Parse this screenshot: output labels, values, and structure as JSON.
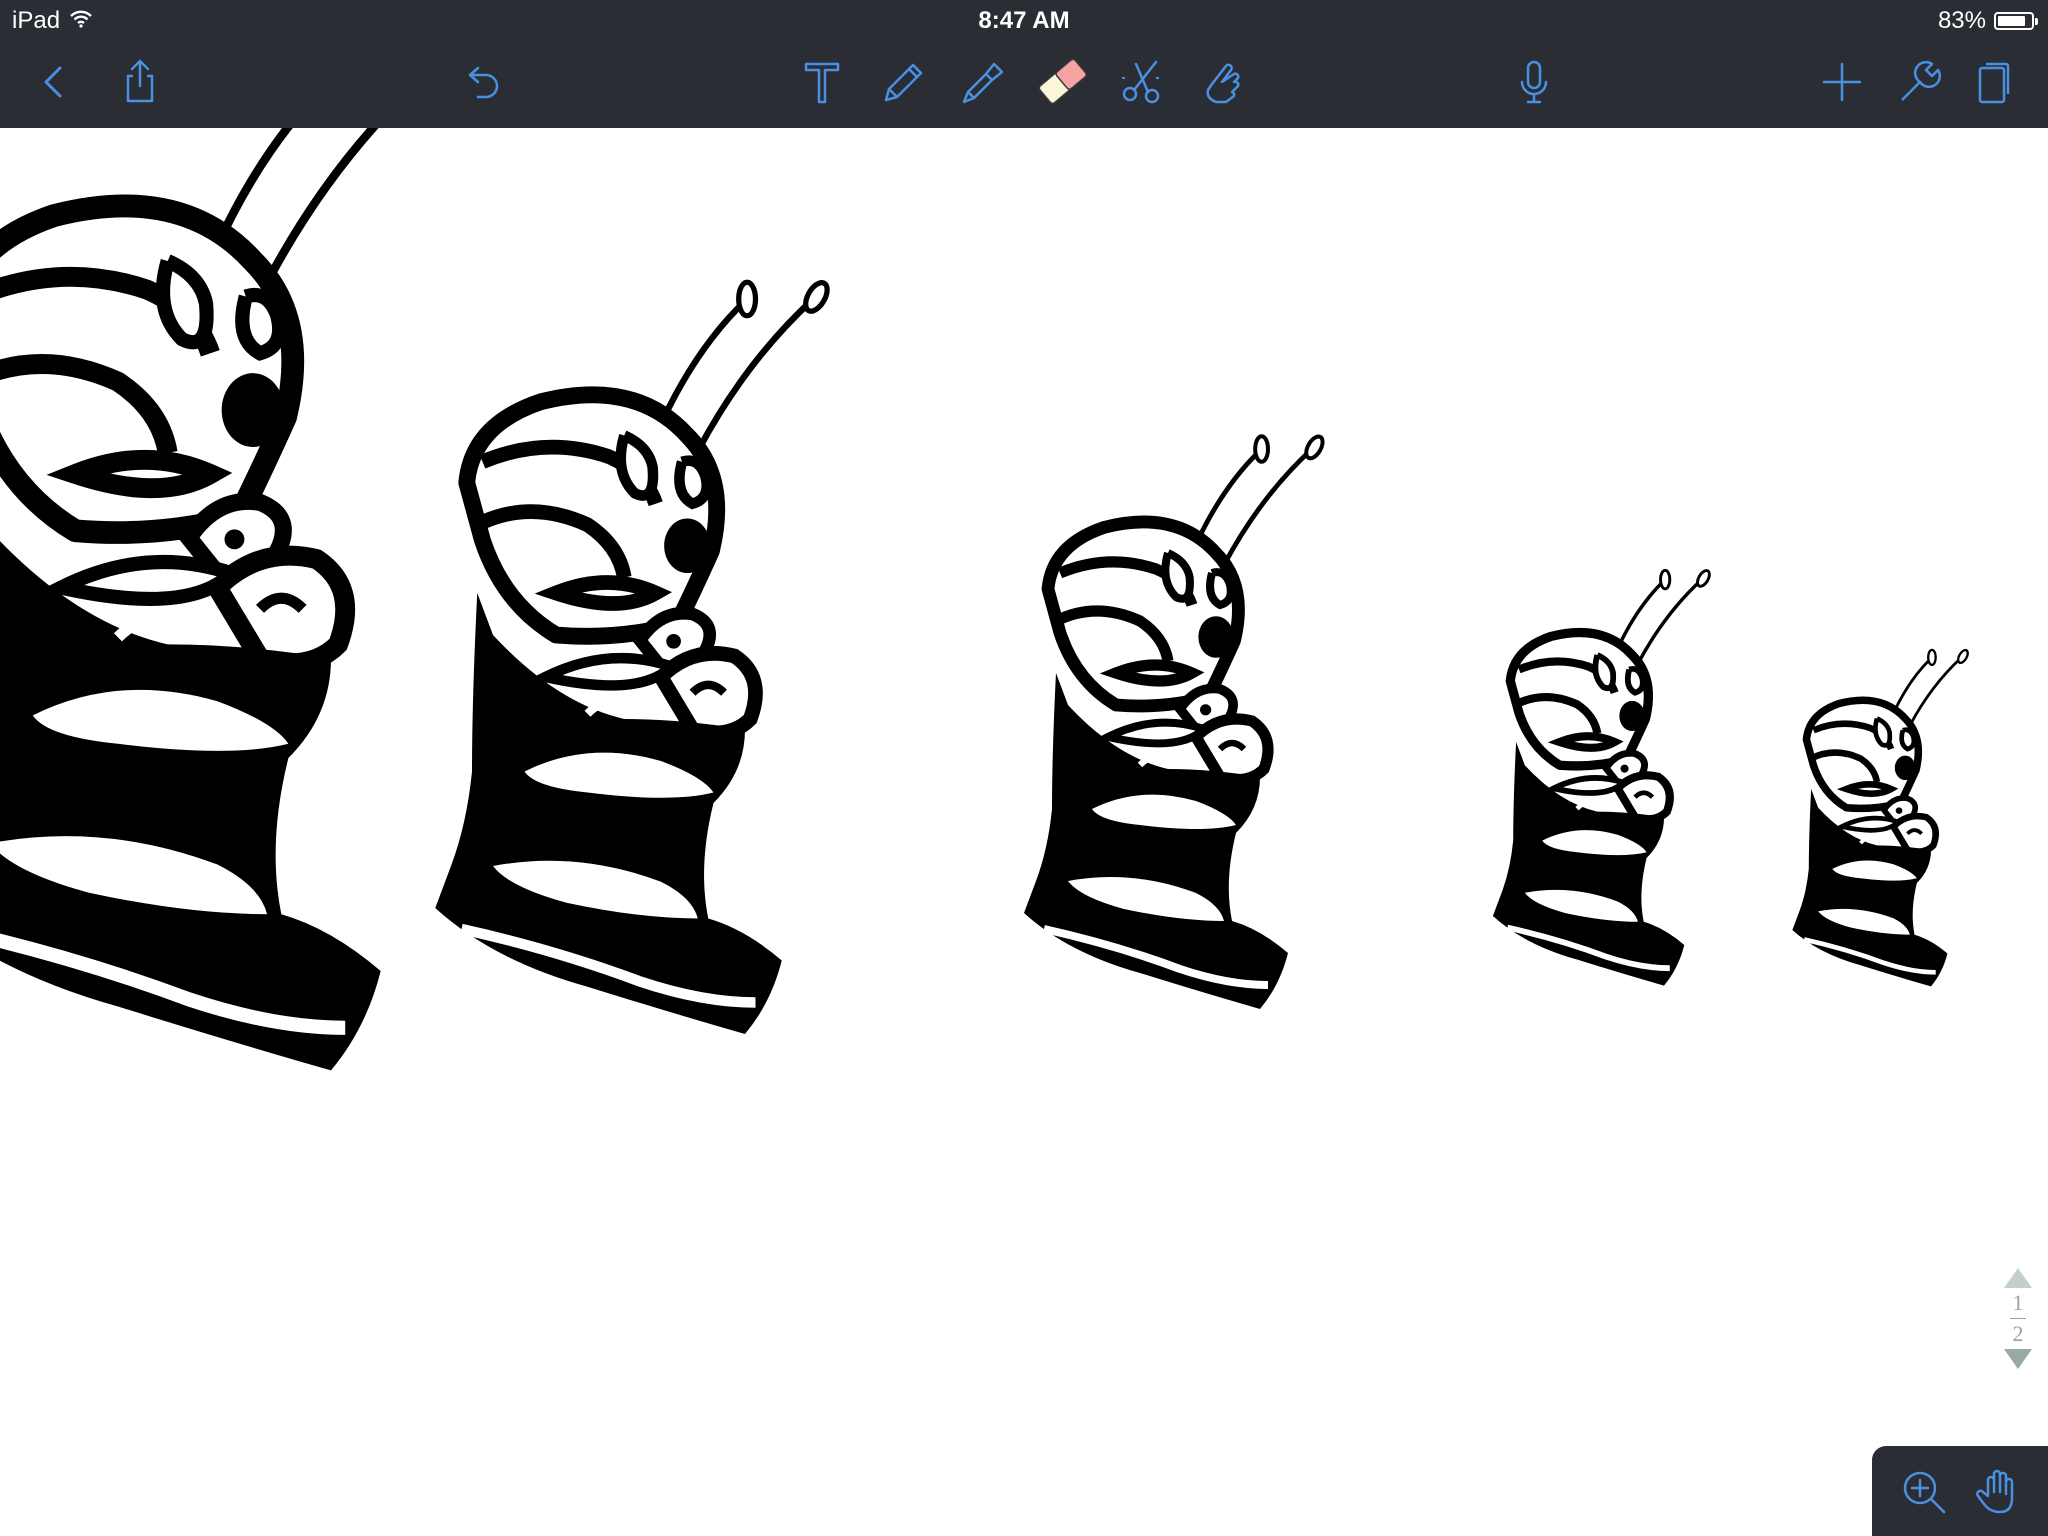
{
  "status_bar": {
    "device": "iPad",
    "time": "8:47 AM",
    "battery_percent": "83%",
    "battery_level": 0.83
  },
  "toolbar": {
    "back_icon": "chevron-left-icon",
    "share_icon": "share-icon",
    "undo_icon": "undo-icon",
    "tools": [
      "text-tool-icon",
      "pencil-icon",
      "highlighter-icon",
      "eraser-icon",
      "scissors-icon",
      "pointer-hand-icon"
    ],
    "selected_tool": "eraser-icon",
    "record_icon": "microphone-icon",
    "add_icon": "plus-icon",
    "settings_icon": "wrench-icon",
    "pages_icon": "pages-icon",
    "icon_color": "#4a90e2",
    "background_color": "#2a2d33"
  },
  "page_indicator": {
    "current_page": "1",
    "total_pages": "2"
  },
  "zoom_panel": {
    "zoom_icon": "zoom-in-icon",
    "hand_icon": "hand-icon"
  }
}
